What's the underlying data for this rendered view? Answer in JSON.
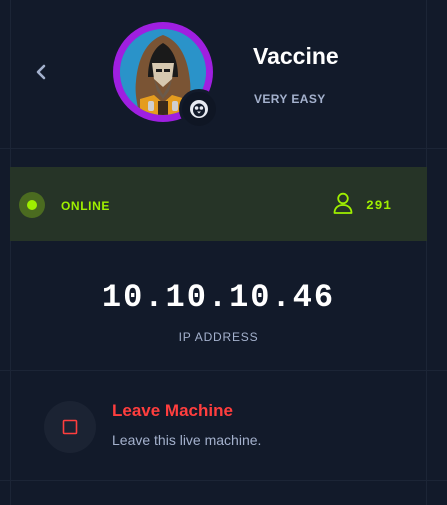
{
  "machine": {
    "name": "Vaccine",
    "difficulty": "VERY EASY",
    "avatar_icon": "hooded-figure-avatar",
    "os_icon": "linux-tux-icon"
  },
  "status": {
    "label": "ONLINE",
    "users_count": "291",
    "color": "#9fef00"
  },
  "connection": {
    "ip": "10.10.10.46",
    "ip_label": "IP ADDRESS"
  },
  "actions": {
    "leave_title": "Leave Machine",
    "leave_description": "Leave this live machine.",
    "leave_color": "#ff3e3e"
  }
}
